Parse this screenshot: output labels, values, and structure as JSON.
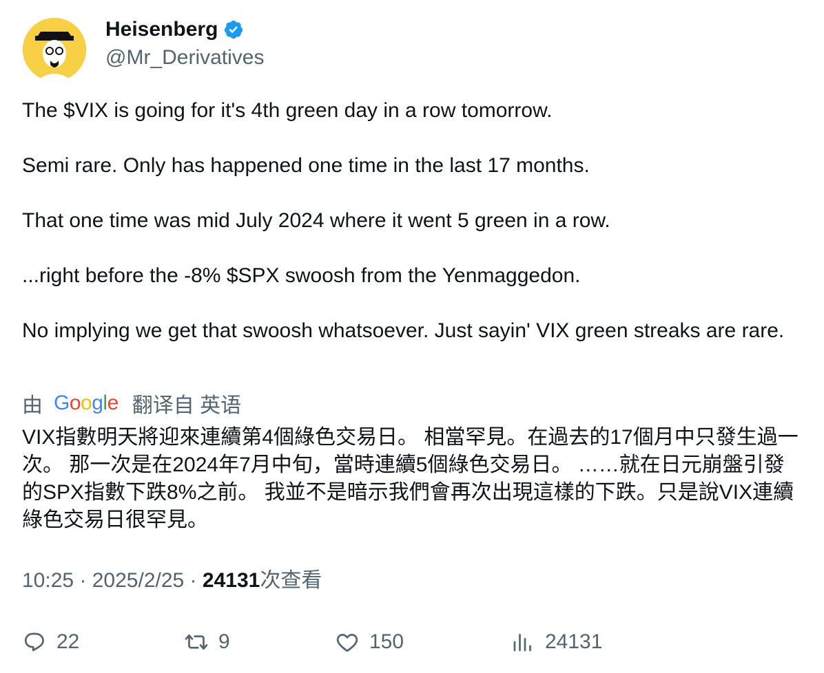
{
  "author": {
    "display_name": "Heisenberg",
    "handle": "@Mr_Derivatives",
    "verified": true,
    "verified_color": "#1d9bf0",
    "avatar_color": "#f7d046"
  },
  "tweet": {
    "text": "The $VIX is going for it's 4th green day in a row tomorrow.\n\nSemi rare. Only has happened one time in the last 17 months.\n\nThat one time was mid July 2024 where it went 5 green in a row.\n\n...right before the -8% $SPX swoosh from the Yenmaggedon.\n\nNo implying we get that swoosh whatsoever. Just sayin' VIX green streaks are rare."
  },
  "translation": {
    "by_label": "由",
    "provider": "Google",
    "label": "翻译自 英语",
    "text": "VIX指數明天將迎來連續第4個綠色交易日。 相當罕見。在過去的17個月中只發生過一次。 那一次是在2024年7月中旬，當時連續5個綠色交易日。 ……就在日元崩盤引發的SPX指數下跌8%之前。 我並不是暗示我們會再次出現這樣的下跌。只是說VIX連續綠色交易日很罕見。"
  },
  "meta": {
    "time": "10:25",
    "separator": " · ",
    "date": "2025/2/25",
    "views_count": "24131",
    "views_label": "次查看"
  },
  "actions": {
    "replies": {
      "icon": "reply-icon",
      "count": "22"
    },
    "retweets": {
      "icon": "retweet-icon",
      "count": "9"
    },
    "likes": {
      "icon": "heart-icon",
      "count": "150"
    },
    "views": {
      "icon": "analytics-icon",
      "count": "24131"
    }
  }
}
